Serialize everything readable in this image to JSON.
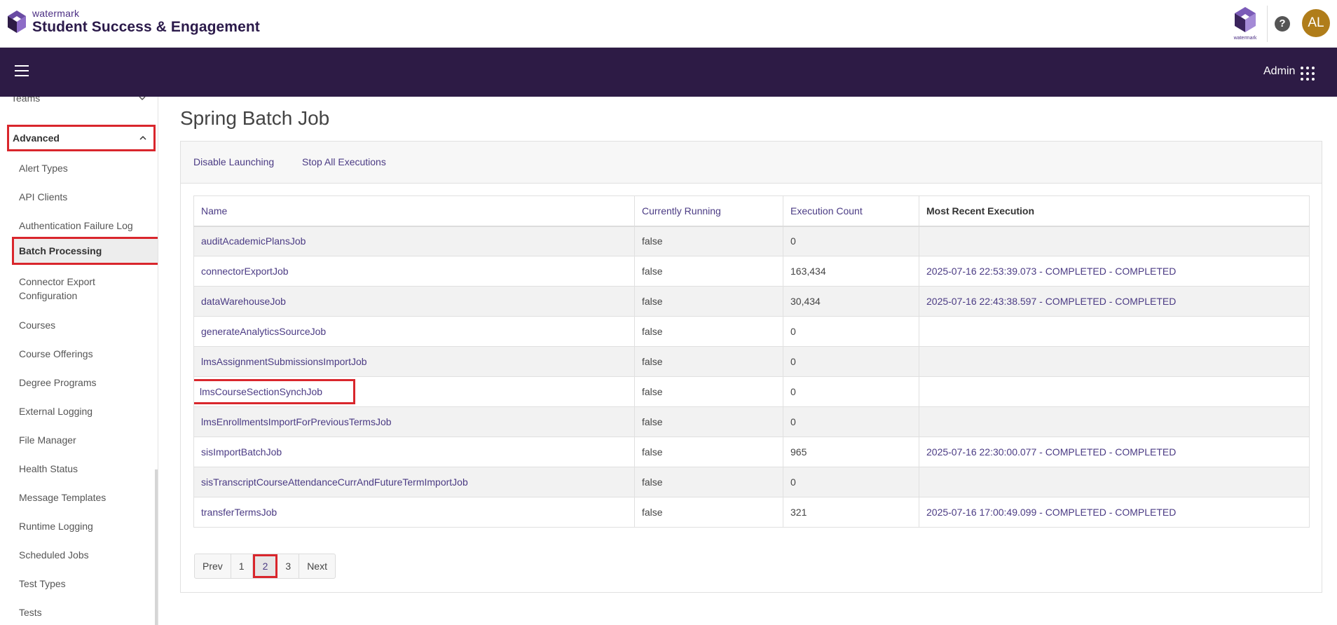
{
  "header": {
    "brand_small": "watermark",
    "brand_big": "Student Success & Engagement",
    "wm_label": "watermark",
    "avatar_initials": "AL"
  },
  "navbar": {
    "admin_label": "Admin"
  },
  "sidebar": {
    "teams_label": "Teams",
    "advanced_label": "Advanced",
    "items": [
      "Alert Types",
      "API Clients",
      "Authentication Failure Log",
      "Batch Processing",
      "Connector Export Configuration",
      "Courses",
      "Course Offerings",
      "Degree Programs",
      "External Logging",
      "File Manager",
      "Health Status",
      "Message Templates",
      "Runtime Logging",
      "Scheduled Jobs",
      "Test Types",
      "Tests"
    ]
  },
  "main": {
    "title": "Spring Batch Job",
    "disable_launching": "Disable Launching",
    "stop_all": "Stop All Executions",
    "columns": [
      "Name",
      "Currently Running",
      "Execution Count",
      "Most Recent Execution"
    ],
    "rows": [
      {
        "name": "auditAcademicPlansJob",
        "running": "false",
        "count": "0",
        "recent": ""
      },
      {
        "name": "connectorExportJob",
        "running": "false",
        "count": "163,434",
        "recent": "2025-07-16 22:53:39.073 - COMPLETED - COMPLETED"
      },
      {
        "name": "dataWarehouseJob",
        "running": "false",
        "count": "30,434",
        "recent": "2025-07-16 22:43:38.597 - COMPLETED - COMPLETED"
      },
      {
        "name": "generateAnalyticsSourceJob",
        "running": "false",
        "count": "0",
        "recent": ""
      },
      {
        "name": "lmsAssignmentSubmissionsImportJob",
        "running": "false",
        "count": "0",
        "recent": ""
      },
      {
        "name": "lmsCourseSectionSynchJob",
        "running": "false",
        "count": "0",
        "recent": ""
      },
      {
        "name": "lmsEnrollmentsImportForPreviousTermsJob",
        "running": "false",
        "count": "0",
        "recent": ""
      },
      {
        "name": "sisImportBatchJob",
        "running": "false",
        "count": "965",
        "recent": "2025-07-16 22:30:00.077 - COMPLETED - COMPLETED"
      },
      {
        "name": "sisTranscriptCourseAttendanceCurrAndFutureTermImportJob",
        "running": "false",
        "count": "0",
        "recent": ""
      },
      {
        "name": "transferTermsJob",
        "running": "false",
        "count": "321",
        "recent": "2025-07-16 17:00:49.099 - COMPLETED - COMPLETED"
      }
    ],
    "pager": {
      "prev": "Prev",
      "pages": [
        "1",
        "2",
        "3"
      ],
      "next": "Next"
    }
  },
  "colors": {
    "nav_bg": "#2d1b45",
    "link": "#4b3b84",
    "highlight": "#d9262c",
    "avatar": "#b07d1a"
  }
}
